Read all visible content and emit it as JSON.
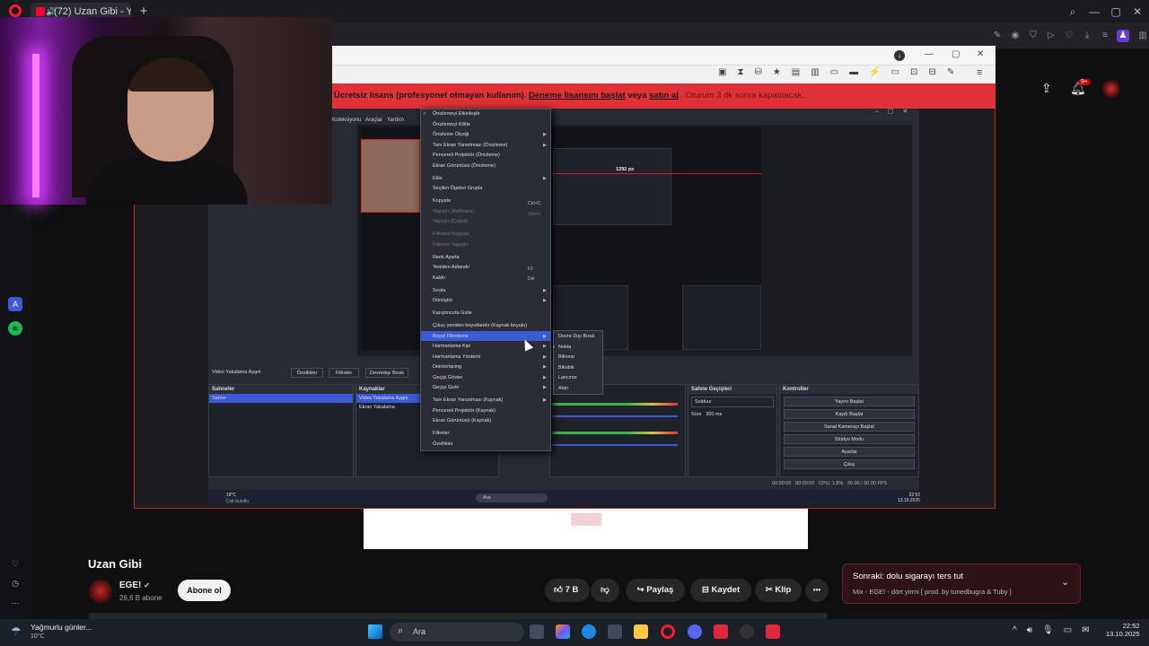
{
  "browser": {
    "tab_title": "(72) Uzan Gibi - YouTu",
    "new_tab": "+",
    "min": "—",
    "max": "▢",
    "close": "✕"
  },
  "video_overlay": {
    "banner_plain": "Ücretsiz lisans (profesyonel olmayan kullanım).",
    "banner_link1": "Deneme lisansını başlat",
    "banner_mid": "veya",
    "banner_link2": "satın al",
    "banner_tail": ". Oturum 3 dk sonra kapatılacak.."
  },
  "obs": {
    "menu_items": [
      "Koleksiyonu",
      "Araçlar",
      "Yardım"
    ],
    "resolution_label": "1292 px",
    "context_menu": [
      {
        "label": "Önizlemeyi Etkinleştir",
        "dim": false
      },
      {
        "label": "Önizlemeyi Kilitle",
        "dim": false
      },
      {
        "label": "Önizleme Ölçeği",
        "dim": false
      },
      {
        "label": "Tam Ekran Yansıtması (Önizleme)",
        "dim": false
      },
      {
        "label": "Pencereli Projektör (Önizleme)",
        "dim": false
      },
      {
        "label": "Ekran Görüntüsü (Önizleme)",
        "dim": false
      },
      {
        "label": "Ekle",
        "dim": false
      },
      {
        "label": "Seçilen Ögeleri Grupla",
        "dim": false
      },
      {
        "label": "Kopyala",
        "dim": false
      },
      {
        "label": "Yapıştır (Referans)",
        "dim": true
      },
      {
        "label": "Yapıştır (Çoğalt)",
        "dim": true
      },
      {
        "label": "Filtreleri Kopyala",
        "dim": true
      },
      {
        "label": "Filtreleri Yapıştır",
        "dim": true
      },
      {
        "label": "Renk Ayarla",
        "dim": false
      },
      {
        "label": "Yeniden Adlandır",
        "dim": false
      },
      {
        "label": "Kaldır",
        "dim": false
      },
      {
        "label": "Sırala",
        "dim": false
      },
      {
        "label": "Dönüştür",
        "dim": false
      },
      {
        "label": "Karıştırıcıda Gizle",
        "dim": false
      },
      {
        "label": "Çıkışı yeniden boyutlandır (Kaynak boyutu)",
        "dim": false
      },
      {
        "label": "Boyut Filtreleme",
        "dim": false
      },
      {
        "label": "Harmanlama Kipi",
        "dim": false
      },
      {
        "label": "Harmanlama Yöntemi",
        "dim": false
      },
      {
        "label": "Deinterlacing",
        "dim": false
      },
      {
        "label": "Geçişi Göster",
        "dim": false
      },
      {
        "label": "Geçişi Gizle",
        "dim": false
      },
      {
        "label": "Tam Ekran Yansıtması (Kaynak)",
        "dim": false
      },
      {
        "label": "Pencereli Projektör (Kaynak)",
        "dim": false
      },
      {
        "label": "Ekran Görüntüsü (Kaynak)",
        "dim": false
      },
      {
        "label": "Filtreler",
        "dim": false
      },
      {
        "label": "Özellikler",
        "dim": false
      }
    ],
    "shortcuts": {
      "copy": "Ctrl+C",
      "paste": "Ctrl+V",
      "rename": "F2",
      "remove": "Del"
    },
    "submenu": [
      "Devre Dışı Bırak",
      "Nokta",
      "Bilinear",
      "Bikübik",
      "Lanczos",
      "Alan"
    ],
    "source_bar": {
      "no_source": "Video Yakalama Aygıtı",
      "props": "Özellikler",
      "filters": "Filtreler",
      "deact": "Devredışı Bırak"
    },
    "scenes_title": "Sahneler",
    "scenes": [
      "Sahne"
    ],
    "sources_title": "Kaynaklar",
    "sources": [
      "Video Yakalama Aygıtı",
      "Ekran Yakalama"
    ],
    "transitions_title": "Sahne Geçişleri",
    "transition_type": "Solduur",
    "duration_label": "Süre",
    "duration": "300 ms",
    "controls_title": "Kontroller",
    "controls": [
      "Yayını Başlat",
      "Kaydı Başlat",
      "Sanal Kamerayı Başlat",
      "Stüdyo Modu",
      "Ayarlar",
      "Çıkış"
    ],
    "status": {
      "time1": "00:00:00",
      "time2": "00:00:00",
      "cpu": "CPU: 1.8%",
      "fps": "30.00 / 30.00 FPS"
    },
    "inner_taskbar": {
      "temp": "19°C",
      "weather": "Çok bulutlu",
      "search": "Ara",
      "time": "22:52",
      "date": "13.10.2025"
    }
  },
  "video": {
    "title": "Uzan Gibi",
    "channel": "EGE!",
    "subscribers": "26,6 B abone",
    "subscribe": "Abone ol",
    "likes": "7 B",
    "share": "Paylaş",
    "save": "Kaydet",
    "clip": "Klip",
    "more": "•••"
  },
  "upnext": {
    "title": "Sonraki: dolu sigarayı ters tut",
    "subtitle": "Mix - EGE! - dört yirmi [ prod. by tunedbugra & Tuby ]"
  },
  "youtube": {
    "notifications": "9+"
  },
  "taskbar": {
    "weather": "Yağmurlu günler...",
    "temp": "10°C",
    "search": "Ara",
    "time": "22:52",
    "date": "13.10.2025"
  }
}
